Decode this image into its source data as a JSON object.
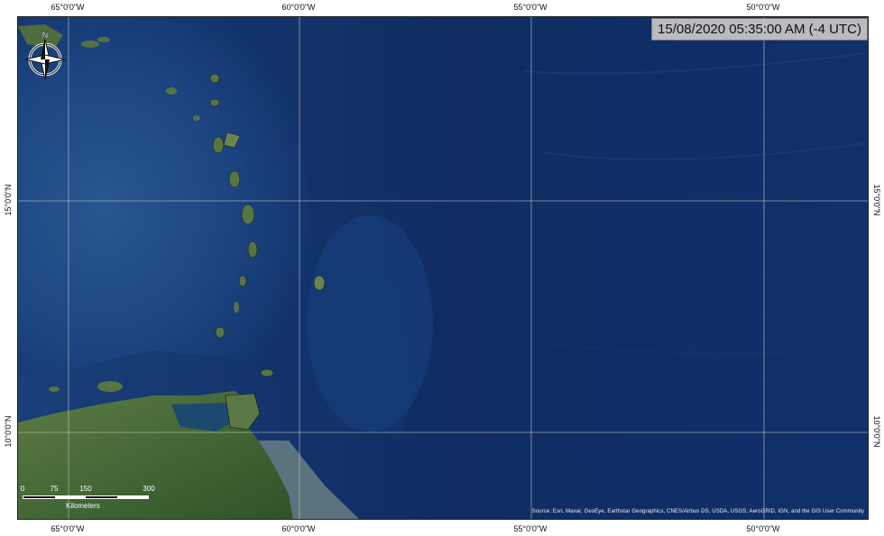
{
  "timestamp": "15/08/2020 05:35:00 AM (-4 UTC)",
  "graticule": {
    "top_labels": [
      "65°0'0\"W",
      "60°0'0\"W",
      "55°0'0\"W",
      "50°0'0\"W"
    ],
    "bottom_labels": [
      "65°0'0\"W",
      "60°0'0\"W",
      "55°0'0\"W",
      "50°0'0\"W"
    ],
    "left_labels": [
      "15°0'0\"N",
      "10°0'0\"N"
    ],
    "right_labels": [
      "15°0'0\"N",
      "10°0'0\"N"
    ]
  },
  "north_arrow": {
    "label": "N"
  },
  "scale_bar": {
    "ticks": [
      "0",
      "75",
      "150",
      "300"
    ],
    "unit": "Kilometers"
  },
  "attribution": "Source: Esri, Maxar, GeoEye, Earthstar Geographics, CNES/Airbus DS, USDA, USGS, AeroGRID, IGN, and the GIS User Community",
  "colors": {
    "ocean_deep": "#0f2e63",
    "ocean_shallow": "#2f5f9e",
    "land": "#4a6b3a",
    "grid": "#c8c8c8",
    "timestamp_bg": "#c8c8c8"
  }
}
